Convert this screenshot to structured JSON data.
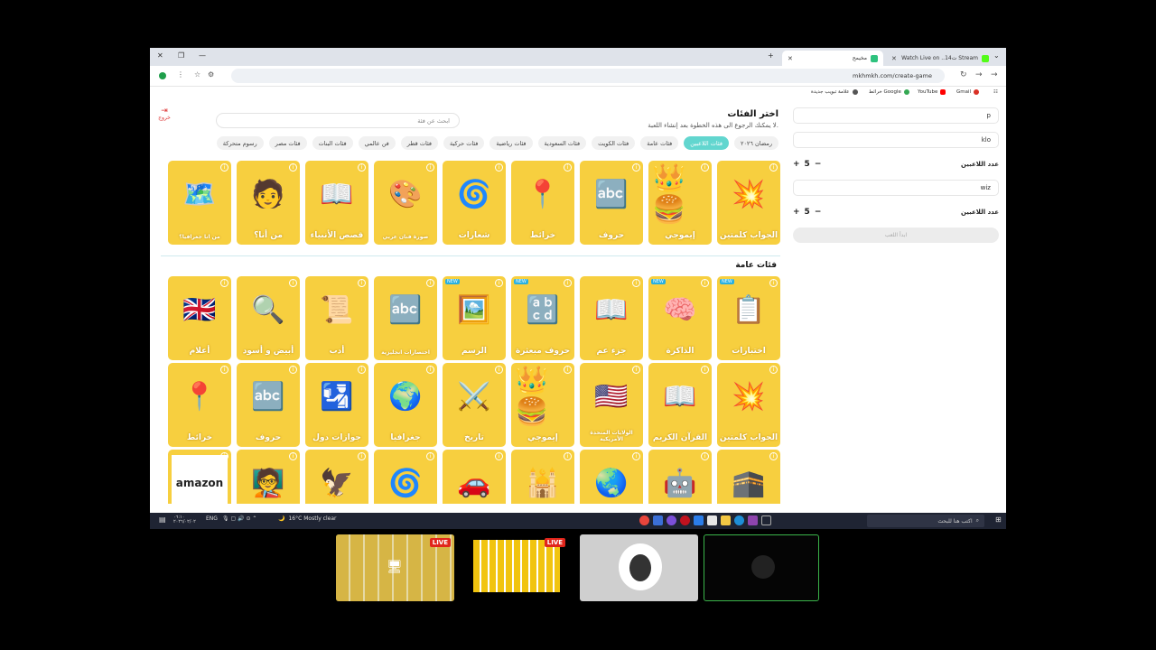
{
  "browser": {
    "tabs": [
      {
        "title": "Watch Live on ..14ت Stream",
        "active": false
      },
      {
        "title": "مخيمح",
        "active": true
      }
    ],
    "new_tab": "+",
    "url": "mkhmkh.com/create-game",
    "bookmarks": [
      "Gmail",
      "YouTube",
      "خرائط Google",
      "علامة تبويب جديدة"
    ]
  },
  "page": {
    "title": "اختر الفئات",
    "subtitle": "لا يمكنك الرجوع الى هذه الخطوة بعد إنشاء اللعبة.",
    "search_placeholder": "ابحث عن فئة",
    "exit_label": "خروج",
    "chips": [
      "رمضان ٢٠٢٦",
      "فئات اللاعبين",
      "فئات عامة",
      "فئات الكويت",
      "فئات السعودية",
      "فئات رياضية",
      "فئات حركية",
      "فئات قطر",
      "فن عالمي",
      "فئات البنات",
      "فئات مصر",
      "رسوم متحركة"
    ],
    "active_chip": 1,
    "section_general": "فئات عامة",
    "row1": [
      {
        "label": "الجواب كلمتين",
        "icon": "gear-puzzle-icon",
        "emoji": "💥"
      },
      {
        "label": "إيموجي",
        "icon": "emoji-icon",
        "emoji": "👑🍔"
      },
      {
        "label": "حروف",
        "icon": "letters-icon",
        "emoji": "🔤"
      },
      {
        "label": "خرائط",
        "icon": "map-pin-icon",
        "emoji": "📍"
      },
      {
        "label": "شعارات",
        "icon": "logo-icon",
        "emoji": "🌀"
      },
      {
        "label": "صورة فنان عربي",
        "icon": "artist-icon",
        "emoji": "🎨",
        "small": true
      },
      {
        "label": "قصص الأنبياء",
        "icon": "book-icon",
        "emoji": "📖"
      },
      {
        "label": "من أنا؟",
        "icon": "person-icon",
        "emoji": "🧑"
      },
      {
        "label": "من انا جغرافيا؟",
        "icon": "africa-icon",
        "emoji": "🗺️",
        "small": true
      }
    ],
    "row2": [
      {
        "label": "اختبارات",
        "icon": "clipboard-icon",
        "emoji": "📋",
        "new": true
      },
      {
        "label": "الذاكرة",
        "icon": "brain-icon",
        "emoji": "🧠",
        "new": true
      },
      {
        "label": "جزء عم",
        "icon": "quran-icon",
        "emoji": "📖"
      },
      {
        "label": "حروف مبعثرة",
        "icon": "scrambled-letters-icon",
        "emoji": "🔡",
        "new": true
      },
      {
        "label": "الرسم",
        "icon": "easel-icon",
        "emoji": "🖼️",
        "new": true
      },
      {
        "label": "اختصارات انجليزية",
        "icon": "abbreviation-icon",
        "emoji": "🔤",
        "small": true
      },
      {
        "label": "أدب",
        "icon": "scroll-icon",
        "emoji": "📜"
      },
      {
        "label": "أبيض و أسود",
        "icon": "magnifier-icon",
        "emoji": "🔍"
      },
      {
        "label": "أعلام",
        "icon": "flags-icon",
        "emoji": "🇬🇧"
      }
    ],
    "row3": [
      {
        "label": "الجواب كلمتين",
        "icon": "gear-puzzle-icon",
        "emoji": "💥"
      },
      {
        "label": "القرآن الكريم",
        "icon": "quran-icon",
        "emoji": "📖"
      },
      {
        "label": "الولايات المتحدة الأمريكية",
        "icon": "usa-icon",
        "emoji": "🇺🇸",
        "small": true
      },
      {
        "label": "إيموجي",
        "icon": "emoji-icon",
        "emoji": "👑🍔"
      },
      {
        "label": "تاريخ",
        "icon": "helmet-icon",
        "emoji": "⚔️"
      },
      {
        "label": "جغرافيا",
        "icon": "globe-icon",
        "emoji": "🌍"
      },
      {
        "label": "جوازات دول",
        "icon": "passport-icon",
        "emoji": "🛂"
      },
      {
        "label": "حروف",
        "icon": "letters-icon",
        "emoji": "🔤"
      },
      {
        "label": "خرائط",
        "icon": "map-pin-icon",
        "emoji": "📍"
      }
    ],
    "row4": [
      {
        "label": "",
        "icon": "kaaba-icon",
        "emoji": "🕋"
      },
      {
        "label": "",
        "icon": "robot-icon",
        "emoji": "🤖"
      },
      {
        "label": "",
        "icon": "globe-plane-icon",
        "emoji": "🌏"
      },
      {
        "label": "",
        "icon": "mosque-icon",
        "emoji": "🕌"
      },
      {
        "label": "",
        "icon": "car-icon",
        "emoji": "🚗"
      },
      {
        "label": "",
        "icon": "logo-icon",
        "emoji": "🌀"
      },
      {
        "label": "",
        "icon": "emblem-icon",
        "emoji": "🦅"
      },
      {
        "label": "",
        "icon": "chalkboard-icon",
        "emoji": "🧑‍🏫"
      },
      {
        "label": "amazon",
        "icon": "amazon-icon",
        "emoji": ""
      }
    ]
  },
  "sidebar": {
    "team1_name": "p",
    "team1_second": "klo",
    "players_label": "عدد اللاعبين",
    "team1_players": "5",
    "team2_name": "wiz",
    "team2_players": "5",
    "start_label": "ابدأ اللعب"
  },
  "taskbar": {
    "search_placeholder": "اكتب هنا للبحث",
    "weather": "16°C  Mostly clear",
    "lang": "ENG"
  },
  "stream": {
    "live_label": "LIVE"
  }
}
